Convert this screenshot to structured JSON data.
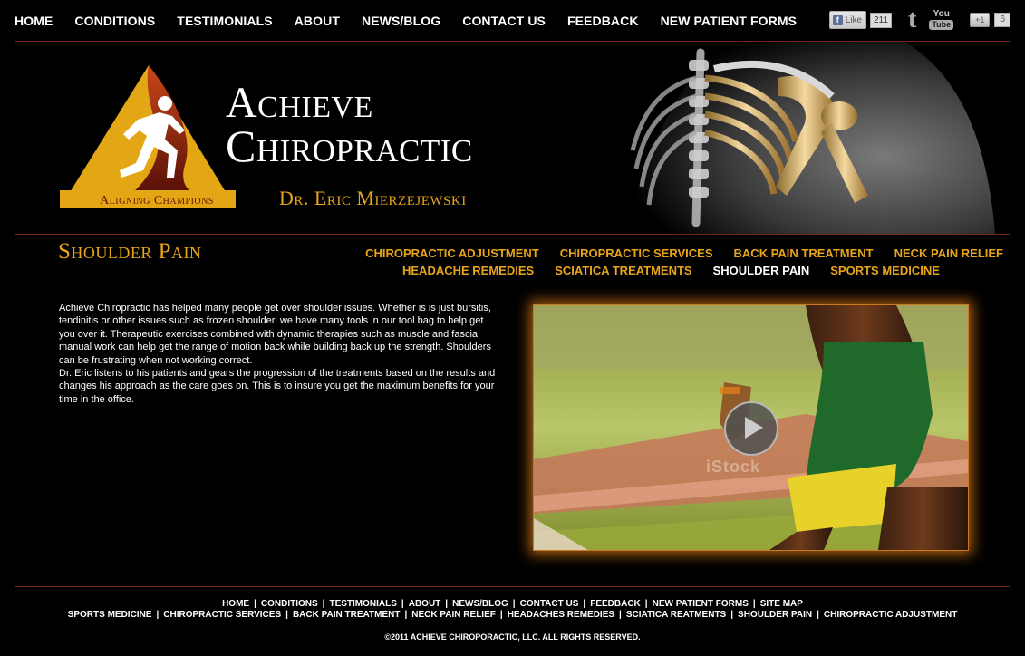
{
  "top_nav": [
    "HOME",
    "CONDITIONS",
    "TESTIMONIALS",
    "ABOUT",
    "NEWS/BLOG",
    "CONTACT US",
    "FEEDBACK",
    "NEW PATIENT FORMS"
  ],
  "social": {
    "fb_like_label": "Like",
    "fb_like_count": "211",
    "gplus_label": "+1",
    "gplus_count": "6",
    "youtube_top": "You",
    "youtube_bottom": "Tube",
    "twitter_glyph": "t"
  },
  "brand": {
    "line1": "Achieve",
    "line2": "Chiropractic",
    "doctor": "Dr. Eric Mierzejewski",
    "tagline": "Aligning Champions"
  },
  "page_title": "Shoulder Pain",
  "condition_nav": {
    "row1": [
      "CHIROPRACTIC ADJUSTMENT",
      "CHIROPRACTIC SERVICES",
      "BACK PAIN TREATMENT",
      "NECK PAIN RELIEF"
    ],
    "row2": [
      "HEADACHE REMEDIES",
      "SCIATICA TREATMENTS",
      "SHOULDER PAIN",
      "SPORTS MEDICINE"
    ],
    "active": "SHOULDER PAIN"
  },
  "body_text": {
    "p1": "Achieve Chiropractic has helped many people get over shoulder issues. Whether is is just bursitis, tendinitis or other issues such as frozen shoulder, we have many tools in our tool bag to help get you over it. Therapeutic exercises combined with dynamic therapies such as muscle and fascia manual work can help get the range of motion back while building back up the strength. Shoulders can be frustrating when not working correct.",
    "p2": "Dr. Eric listens to his patients and gears the progression of the treatments based on the results and changes his approach as the care goes on. This is to insure you get the maximum benefits for your time in the office."
  },
  "video": {
    "watermark": "iStock"
  },
  "footer": {
    "row1": [
      "HOME",
      "CONDITIONS",
      "TESTIMONIALS",
      "ABOUT",
      "NEWS/BLOG",
      "CONTACT US",
      "FEEDBACK",
      "NEW PATIENT FORMS",
      "SITE MAP"
    ],
    "row2": [
      "SPORTS MEDICINE",
      "CHIROPRACTIC SERVICES",
      "BACK PAIN TREATMENT",
      "NECK PAIN RELIEF",
      "HEADACHES REMEDIES",
      "SCIATICA REATMENTS",
      "SHOULDER PAIN",
      "CHIROPRACTIC ADJUSTMENT"
    ],
    "separator": "|",
    "copyright": "©2011 ACHIEVE CHIROPORACTIC, LLC. ALL RIGHTS RESERVED."
  },
  "colors": {
    "accent_gold": "#e8a51a",
    "divider_red": "#7a2418",
    "background": "#000000"
  },
  "icons": [
    "facebook-like-icon",
    "twitter-icon",
    "youtube-icon",
    "gplus-icon",
    "play-icon",
    "runner-logo-icon"
  ]
}
